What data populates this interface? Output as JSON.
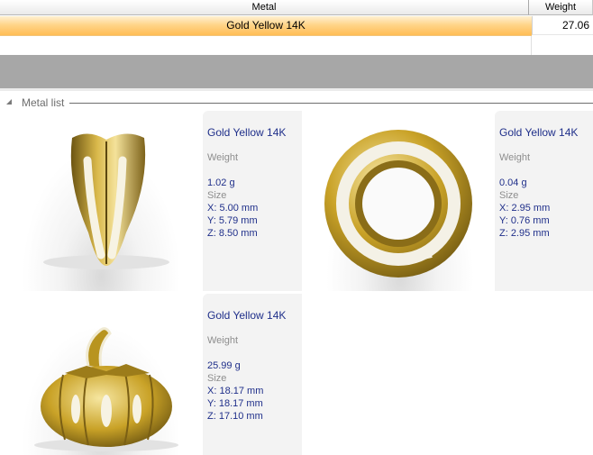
{
  "table": {
    "headers": {
      "metal": "Metal",
      "weight": "Weight"
    },
    "rows": [
      {
        "metal": "Gold Yellow 14K",
        "weight": "27.06"
      }
    ]
  },
  "group": {
    "title": "Metal list"
  },
  "items": [
    {
      "metal": "Gold Yellow 14K",
      "weight_label": "Weight",
      "weight": "1.02 g",
      "size_label": "Size",
      "x": "X: 5.00 mm",
      "y": "Y: 5.79 mm",
      "z": "Z: 8.50 mm",
      "icon": "gold-prong-head-icon"
    },
    {
      "metal": "Gold Yellow 14K",
      "weight_label": "Weight",
      "weight": "0.04 g",
      "size_label": "Size",
      "x": "X: 2.95 mm",
      "y": "Y: 0.76 mm",
      "z": "Z: 2.95 mm",
      "icon": "gold-ring-icon"
    },
    {
      "metal": "Gold Yellow 14K",
      "weight_label": "Weight",
      "weight": "25.99 g",
      "size_label": "Size",
      "x": "X: 18.17 mm",
      "y": "Y: 18.17 mm",
      "z": "Z: 17.10 mm",
      "icon": "gold-pumpkin-icon"
    }
  ],
  "colors": {
    "selected_row": "#ffd58a",
    "metal_text": "#1f2f8a",
    "label_text": "#8e8e8e",
    "gold": "#c9a227"
  }
}
